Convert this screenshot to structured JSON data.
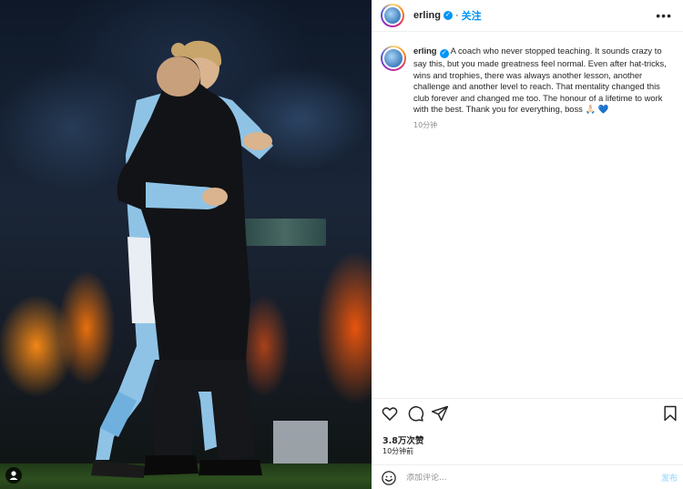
{
  "post": {
    "image_alt": "Two men embracing on a football pitch at night",
    "username": "erling",
    "verified_icon": "verified-badge-icon",
    "follow_label": "关注",
    "more_icon": "more-options-icon",
    "caption": "A coach who never stopped teaching. It sounds crazy to say this, but you made greatness feel normal. Even after hat-tricks, wins and trophies, there was always another lesson, another challenge and another level to reach. That mentality changed this club forever and changed me too. The honour of a lifetime to work with the best. Thank you for everything, boss",
    "caption_emoji_1": "🙏🏻",
    "caption_emoji_2": "💙",
    "caption_time": "10分钟",
    "likes": "3.8万次赞",
    "post_time": "10分钟前",
    "comment_placeholder": "添加评论...",
    "post_button": "发布",
    "user_tag_icon": "person-icon"
  },
  "actions": [
    {
      "name": "like-heart-icon"
    },
    {
      "name": "comment-bubble-icon"
    },
    {
      "name": "share-send-icon"
    },
    {
      "name": "save-bookmark-icon"
    }
  ],
  "colors": {
    "link_blue": "#0095f6",
    "text": "#262626",
    "muted": "#8e8e8e",
    "divider": "#efefef"
  }
}
